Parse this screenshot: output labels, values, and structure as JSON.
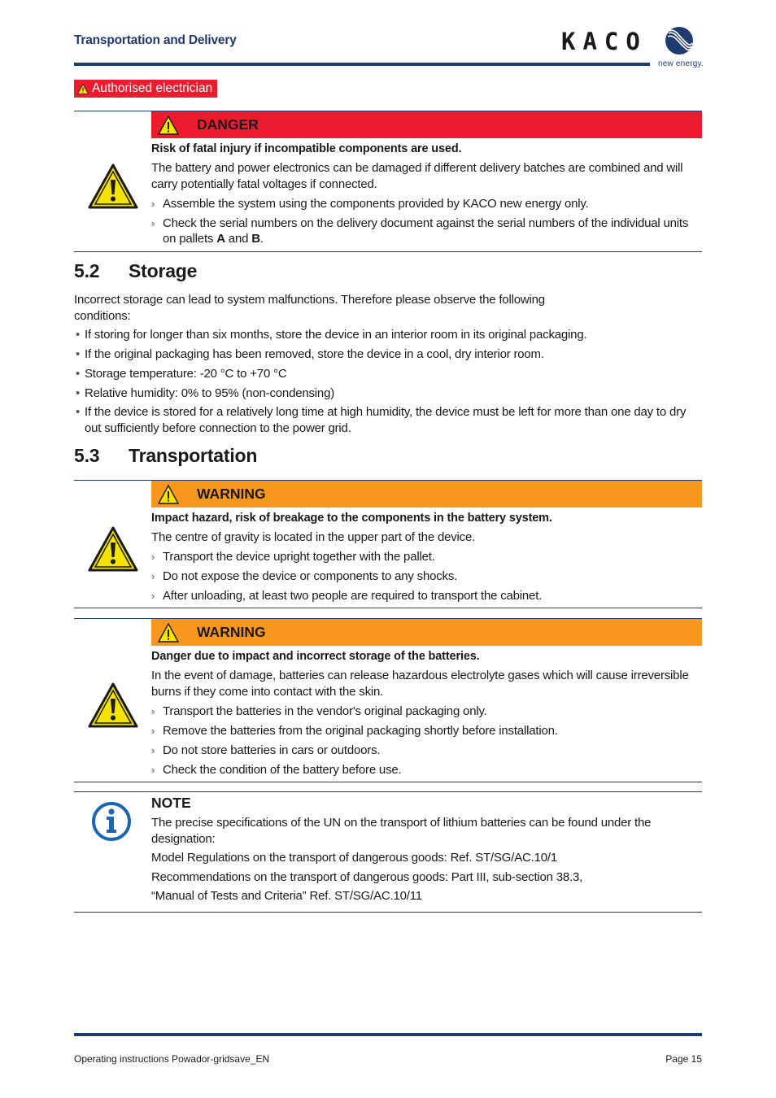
{
  "header": {
    "section_title": "Transportation and Delivery",
    "logo_text": "KACO",
    "logo_tagline": "new energy.",
    "brand_color": "#1f3a6e"
  },
  "role_badge": {
    "icon": "warning-triangle-icon",
    "label": "Authorised electrician",
    "color": "#ec1c2e"
  },
  "danger_box": {
    "level": "DANGER",
    "color": "#ec1c2e",
    "icon": "warning-triangle-icon",
    "lead": "Risk of fatal injury if incompatible components are used.",
    "text": "The battery and power electronics can be damaged if different delivery batches are combined and will carry potentially fatal voltages if connected.",
    "steps": [
      "Assemble the system using the components provided by KACO new energy only.",
      "Check the serial numbers on the delivery document against the serial numbers of the individual units on pallets A and B."
    ],
    "step2_parts": {
      "before": "Check the serial numbers on the delivery document against the serial numbers of the individual units on pallets ",
      "a": "A",
      "mid": " and ",
      "b": "B",
      "after": "."
    }
  },
  "storage": {
    "number": "5.2",
    "title": "Storage",
    "intro_line1": "Incorrect storage can lead to system malfunctions. Therefore please observe the following",
    "intro_line2": "conditions:",
    "bullets": [
      "If storing for longer than six months, store the device in an interior room in its original packaging.",
      "If the original packaging has been removed, store the device in a cool, dry interior room.",
      "Storage temperature: -20 °C to +70 °C",
      "Relative humidity: 0% to 95% (non-condensing)",
      "If the device is stored for a relatively long time at high humidity, the device must be left for more than one day to dry out sufficiently before connection to the power grid."
    ]
  },
  "transportation": {
    "number": "5.3",
    "title": "Transportation",
    "warning1": {
      "level": "WARNING",
      "color": "#f7981d",
      "lead": "Impact hazard, risk of breakage to the components in the battery system.",
      "text": "The centre of gravity is located in the upper part of the device.",
      "steps": [
        "Transport the device upright together with the pallet.",
        "Do not expose the device or components to any shocks.",
        "After unloading, at least two people are required to transport the cabinet."
      ]
    },
    "warning2": {
      "level": "WARNING",
      "color": "#f7981d",
      "lead": "Danger due to impact and incorrect storage of the batteries.",
      "text": "In the event of damage, batteries can release hazardous electrolyte gases which will cause irreversible burns if they come into contact with the skin.",
      "steps": [
        "Transport the batteries in the vendor's original packaging only.",
        "Remove the batteries from the original packaging shortly before installation.",
        "Do not store batteries in cars or outdoors.",
        "Check the condition of the battery before use."
      ]
    },
    "note": {
      "icon": "info-icon",
      "title": "NOTE",
      "text": "The precise specifications of the UN on the transport of lithium batteries can be found under the designation:",
      "lines": [
        "Model Regulations on the transport of dangerous goods: Ref. ST/SG/AC.10/1",
        "Recommendations on the transport of dangerous goods: Part III, sub-section 38.3,",
        "“Manual of Tests and Criteria” Ref. ST/SG/AC.10/11"
      ]
    }
  },
  "footer": {
    "document": "Operating instructions Powador-gridsave_EN",
    "page": "Page 15"
  },
  "step_marker": "›",
  "bullet_marker": "•"
}
